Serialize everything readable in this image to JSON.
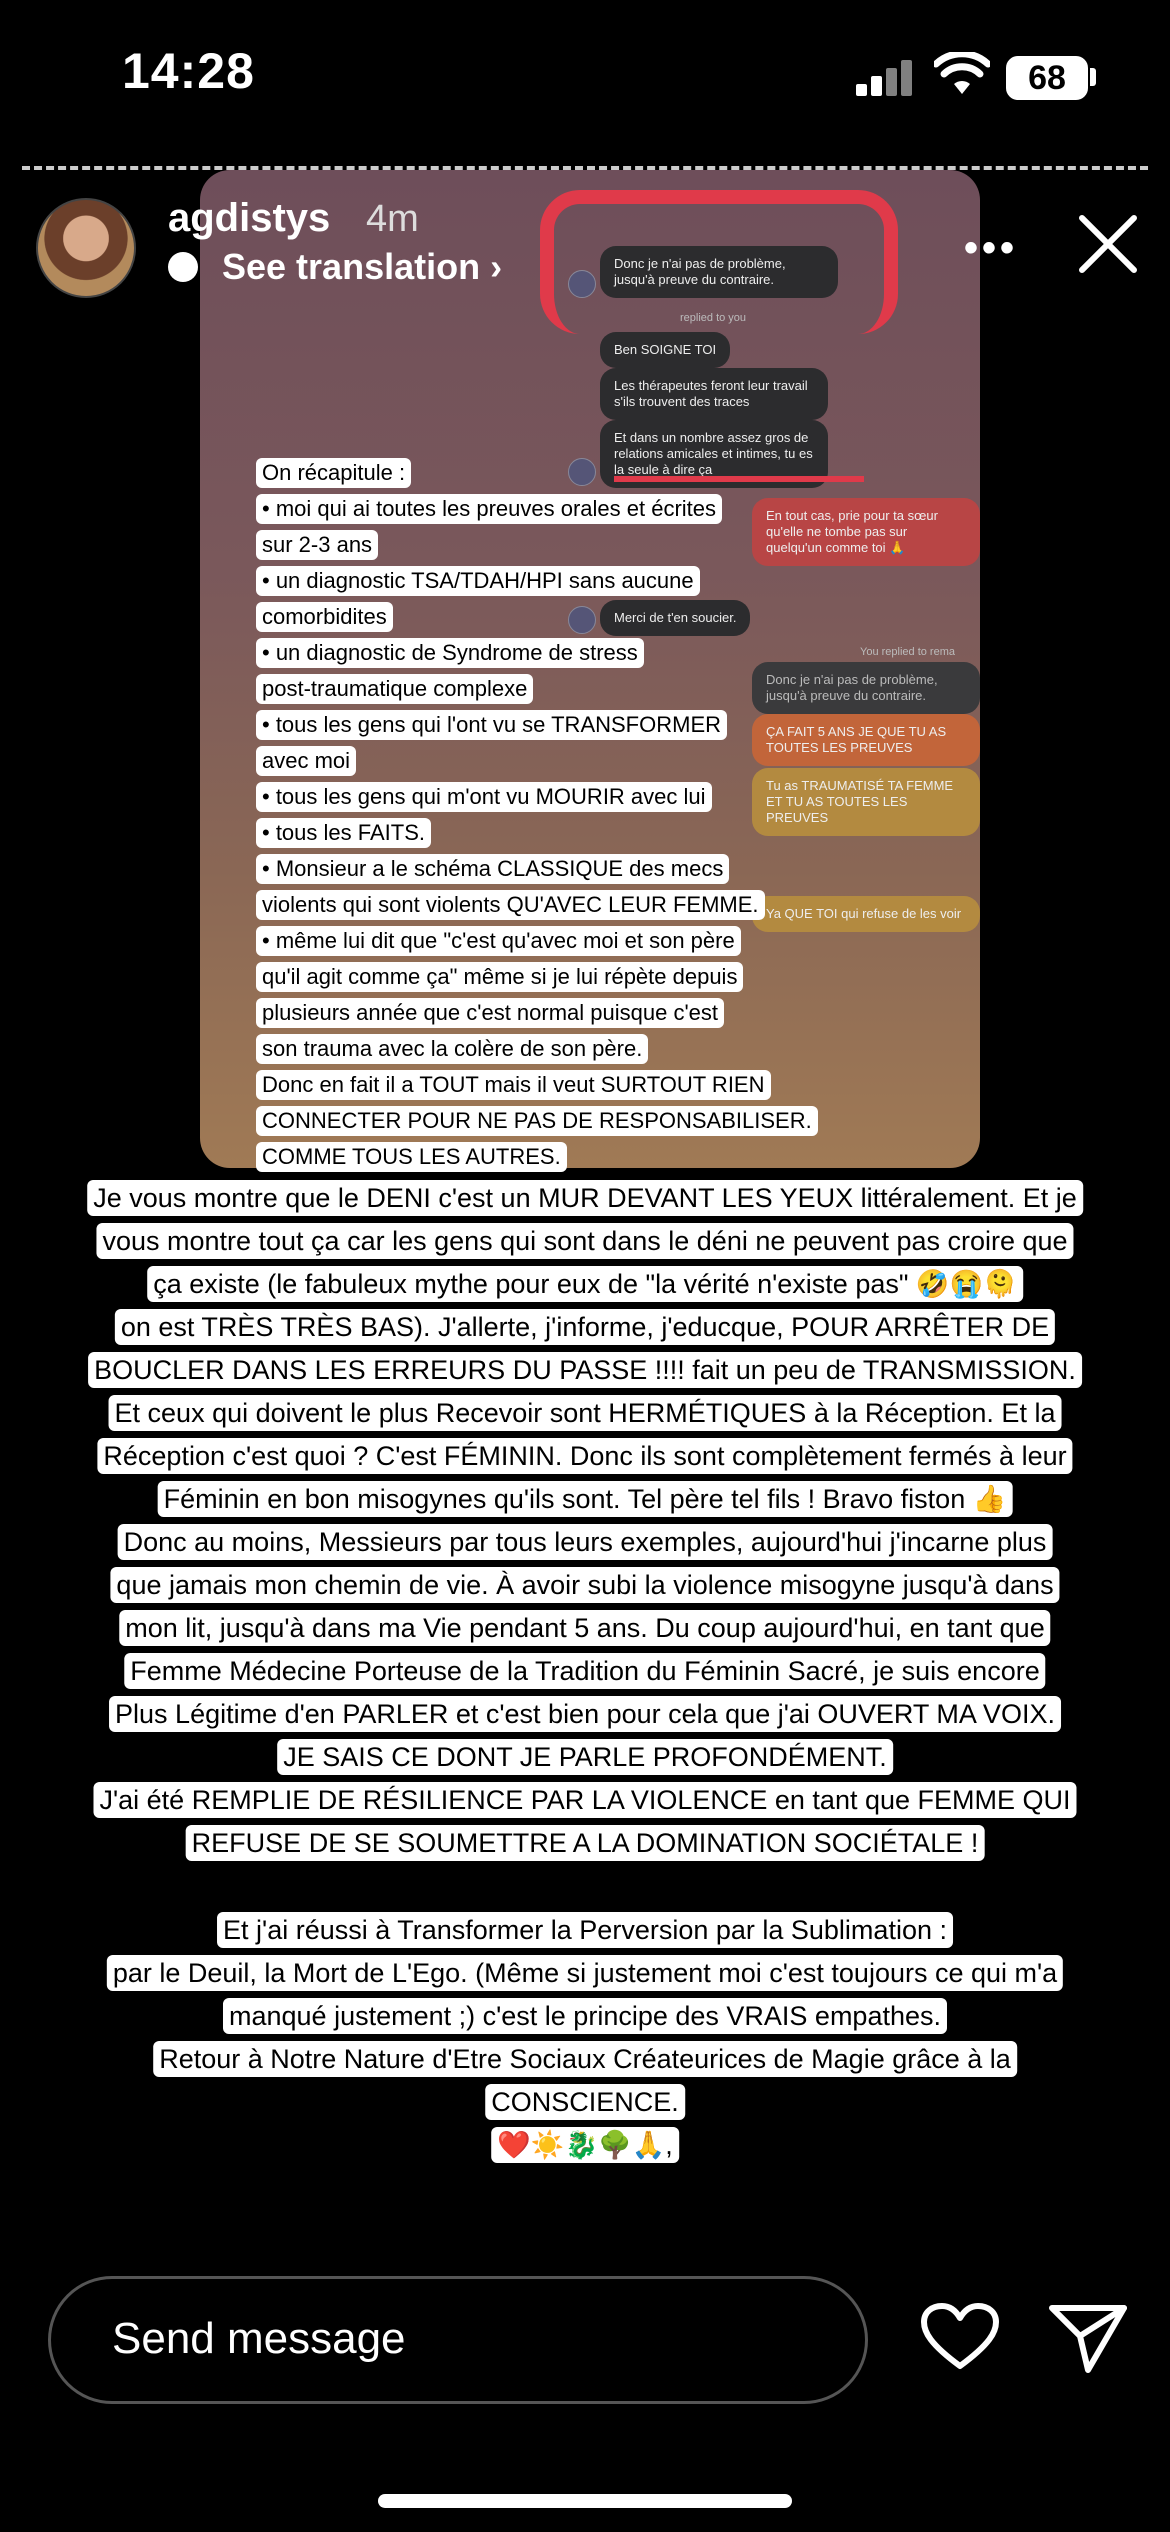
{
  "status_bar": {
    "time": "14:28",
    "battery": "68"
  },
  "story": {
    "username": "agdistys",
    "time_ago": "4m",
    "translation_label": "See translation",
    "more_icon": "more-dots-icon",
    "close_icon": "close-icon"
  },
  "dm_screenshot": {
    "msg1": "Donc je n'ai pas de problème, jusqu'à preuve du contraire.",
    "replied_note": "replied to you",
    "msg2": "Ben SOIGNE TOI",
    "msg3": "Les thérapeutes feront leur travail s'ils trouvent des traces",
    "msg4": "Et dans un nombre assez gros de relations amicales et intimes, tu es la seule à dire ça",
    "msg5": "En tout cas, prie pour ta sœur qu'elle ne tombe pas sur quelqu'un comme toi 🙏",
    "msg6": "Merci de t'en soucier.",
    "replied_note2": "You replied to rema",
    "msg7": "Donc je n'ai pas de problème, jusqu'à preuve du contraire.",
    "msg8": "ÇA FAIT 5 ANS JE QUE TU AS TOUTES LES PREUVES",
    "msg9": "Tu as TRAUMATISÉ TA FEMME ET TU AS TOUTES LES PREUVES",
    "msg10": "Ya QUE TOI qui refuse de les voir"
  },
  "recap_lines": [
    "On récapitule :",
    "• moi qui ai toutes les preuves orales et écrites",
    "sur 2-3 ans",
    "• un diagnostic TSA/TDAH/HPI sans aucune",
    "comorbidites",
    "• un diagnostic de Syndrome de stress",
    "post-traumatique complexe",
    "• tous les gens qui l'ont vu se TRANSFORMER",
    "avec moi",
    "• tous les gens qui m'ont vu MOURIR avec lui",
    "• tous les FAITS.",
    "• Monsieur a le schéma CLASSIQUE des mecs",
    "violents qui sont violents QU'AVEC LEUR FEMME.",
    "• même lui dit que \"c'est qu'avec moi et son père",
    "qu'il agit comme ça\" même si je lui répète depuis",
    "plusieurs année que c'est normal puisque c'est",
    "son trauma avec la colère de son père.",
    "Donc en fait il a TOUT mais il veut SURTOUT RIEN",
    "CONNECTER POUR NE PAS DE RESPONSABILISER.",
    "COMME TOUS LES AUTRES."
  ],
  "main_lines": [
    "Je vous montre que le DENI c'est un MUR DEVANT LES YEUX littéralement. Et je",
    "vous montre tout ça car les gens qui sont dans le déni ne peuvent pas croire que",
    "ça existe (le fabuleux mythe pour eux de \"la vérité n'existe pas\" 🤣😭🫠",
    "on est TRÈS TRÈS BAS). J'allerte, j'informe, j'educque, POUR ARRÊTER DE",
    "BOUCLER DANS LES ERREURS DU PASSE !!!! fait un peu de TRANSMISSION.",
    "Et ceux qui doivent le plus Recevoir sont HERMÉTIQUES à la Réception. Et la",
    "Réception c'est quoi ? C'est FÉMININ. Donc ils sont complètement fermés à leur",
    "Féminin en bon misogynes qu'ils sont.  Tel père tel fils ! Bravo fiston 👍",
    "Donc au moins, Messieurs par tous leurs exemples, aujourd'hui j'incarne plus",
    "que jamais mon chemin de vie. À avoir subi la violence misogyne jusqu'à dans",
    "mon lit, jusqu'à dans ma Vie pendant 5 ans. Du coup aujourd'hui, en tant que",
    "Femme Médecine Porteuse de la Tradition du Féminin Sacré, je suis encore",
    "Plus Légitime d'en PARLER et c'est bien pour cela que j'ai OUVERT MA VOIX.",
    "JE SAIS CE DONT JE PARLE PROFONDÉMENT.",
    "J'ai été REMPLIE DE RÉSILIENCE PAR LA VIOLENCE en tant que FEMME QUI",
    "REFUSE DE SE SOUMETTRE  A LA DOMINATION SOCIÉTALE !",
    "Et j'ai réussi à Transformer la Perversion par la Sublimation :",
    "par le Deuil, la Mort de L'Ego. (Même si justement moi c'est toujours ce qui m'a",
    "manqué justement ;) c'est le principe des VRAIS empathes.",
    "Retour à Notre Nature d'Etre Sociaux Créateurices de Magie grâce à la",
    "CONSCIENCE.",
    "❤️☀️🐉🌳🙏,"
  ],
  "footer": {
    "send_placeholder": "Send message",
    "like_icon": "heart-icon",
    "share_icon": "paper-plane-icon"
  }
}
